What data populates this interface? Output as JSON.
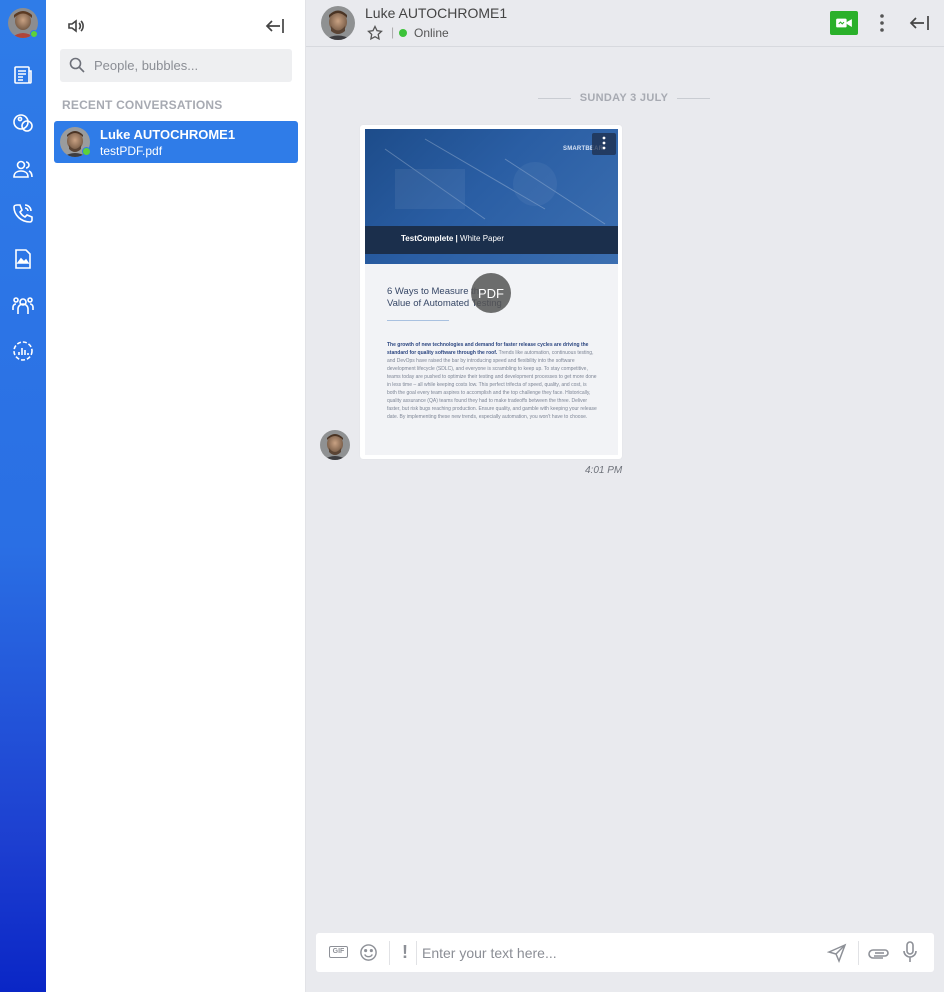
{
  "sidebar_rail": {
    "items": [
      "news-icon",
      "bubbles-icon",
      "contacts-icon",
      "calls-icon",
      "files-icon",
      "groups-icon",
      "analytics-icon"
    ]
  },
  "conversations_panel": {
    "search_placeholder": "People, bubbles...",
    "recent_title": "RECENT CONVERSATIONS",
    "items": [
      {
        "name": "Luke AUTOCHROME1",
        "last_message": "testPDF.pdf",
        "status": "online"
      }
    ]
  },
  "chat_header": {
    "contact_name": "Luke AUTOCHROME1",
    "separator": "|",
    "status_text": "Online"
  },
  "chat": {
    "date_separator": "SUNDAY 3 JULY",
    "message": {
      "time": "4:01 PM",
      "attachment": {
        "badge": "PDF",
        "preview": {
          "brand": "TestComplete",
          "brand_sub": "White Paper",
          "publisher": "SMARTBEAR",
          "title": "6 Ways to Measure the Value of Automated Testing",
          "lead": "The growth of new technologies and demand for faster release cycles are driving the standard for quality software through the roof.",
          "body": "Trends like automation, continuous testing, and DevOps have raised the bar by introducing speed and flexibility into the software development lifecycle (SDLC), and everyone is scrambling to keep up. To stay competitive, teams today are pushed to optimize their testing and development processes to get more done in less time – all while keeping costs low. This perfect trifecta of speed, quality, and cost, is both the goal every team aspires to accomplish and the top challenge they face. Historically, quality assurance (QA) teams found they had to make tradeoffs between the three. Deliver faster, but risk bugs reaching production. Ensure quality, and gamble with keeping your release date. By implementing these new trends, especially automation, you won't have to choose."
        }
      }
    }
  },
  "composer": {
    "gif_label": "GIF",
    "urgency_label": "!",
    "input_placeholder": "Enter your text here..."
  },
  "colors": {
    "rail_top": "#2f7ce8",
    "rail_bottom": "#0a26c6",
    "selected_item": "#2f7ce8",
    "online": "#3cc23a",
    "video_button": "#2ab02a"
  }
}
